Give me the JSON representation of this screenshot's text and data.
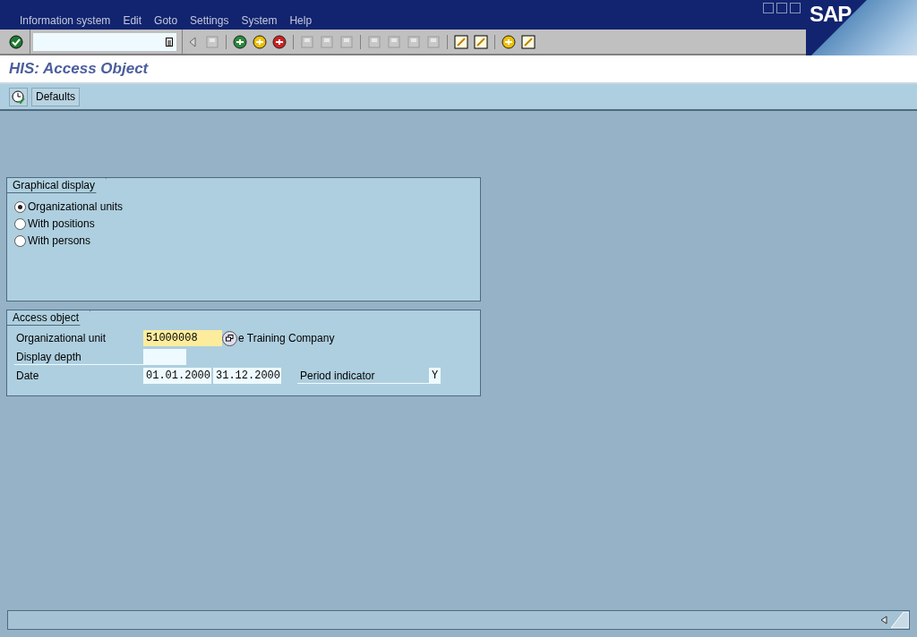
{
  "menu_bar": [
    "Information system",
    "Edit",
    "Goto",
    "Settings",
    "System",
    "Help"
  ],
  "logo": "SAP",
  "title": "HIS: Access Object",
  "app_toolbar": {
    "button": "Defaults"
  },
  "graphical_display": {
    "title": "Graphical display",
    "options": [
      {
        "label": "Organizational units",
        "selected": true
      },
      {
        "label": "With positions",
        "selected": false
      },
      {
        "label": "With persons",
        "selected": false
      }
    ]
  },
  "access_object": {
    "title": "Access object",
    "org_unit": {
      "label": "Organizational unit",
      "value": "51000008",
      "focused": true,
      "description": "e Training Company"
    },
    "display_depth": {
      "label": "Display depth"
    },
    "date": {
      "label": "Date",
      "from": "01.01.2000",
      "to": "31.12.2000"
    },
    "period_indicator": {
      "label": "Period indicator",
      "value": "Y"
    }
  }
}
